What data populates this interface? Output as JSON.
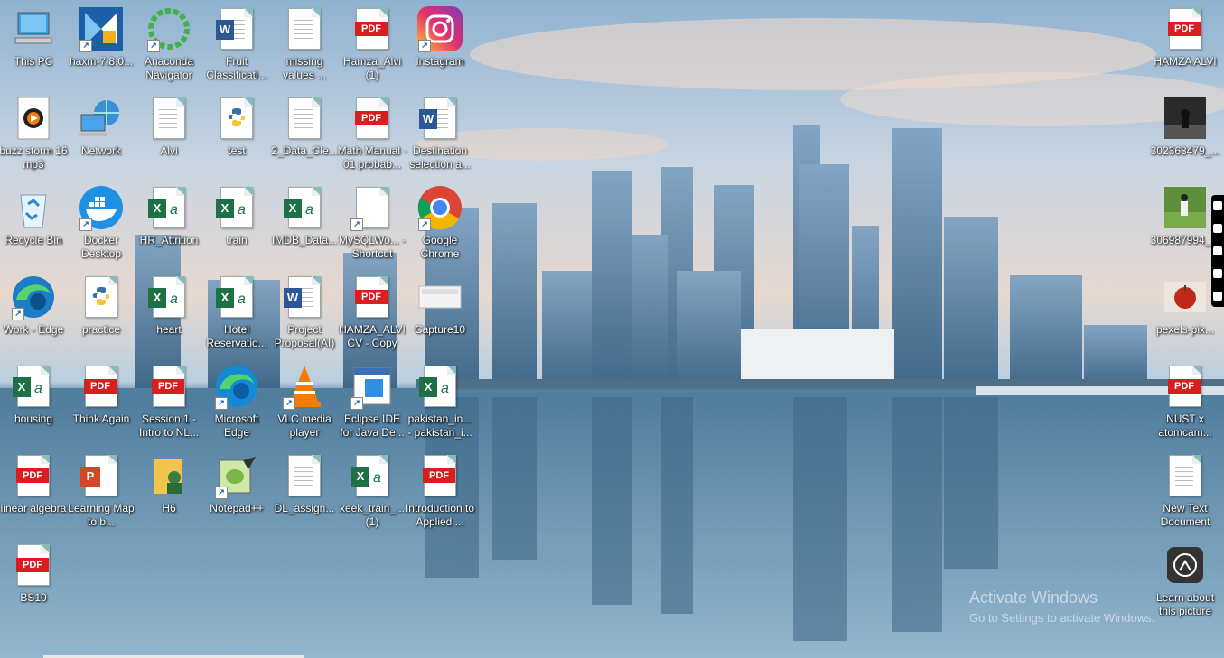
{
  "desktop": {
    "icons": [
      {
        "label": "This PC",
        "type": "pc"
      },
      {
        "label": "haxm-7.8.0...",
        "type": "haxm",
        "shortcut": true
      },
      {
        "label": "Anaconda Navigator",
        "type": "anaconda",
        "shortcut": true
      },
      {
        "label": "Fruit Classificati...",
        "type": "word"
      },
      {
        "label": "missing values ...",
        "type": "text"
      },
      {
        "label": "Hamza_Alvi (1)",
        "type": "pdf"
      },
      {
        "label": "Instagram",
        "type": "instagram",
        "shortcut": true
      },
      {
        "label": "buzz storm 16 mp3",
        "type": "media"
      },
      {
        "label": "Network",
        "type": "network"
      },
      {
        "label": "Alvi",
        "type": "text"
      },
      {
        "label": "test",
        "type": "python"
      },
      {
        "label": "2_Data_Cle...",
        "type": "text"
      },
      {
        "label": "Math Manual - 01 probab...",
        "type": "pdf"
      },
      {
        "label": "Destination selection a...",
        "type": "word"
      },
      {
        "label": "Recycle Bin",
        "type": "recycle"
      },
      {
        "label": "Docker Desktop",
        "type": "docker",
        "shortcut": true
      },
      {
        "label": "HR_Attrition",
        "type": "excel"
      },
      {
        "label": "train",
        "type": "excel"
      },
      {
        "label": "IMDB_Data...",
        "type": "excel"
      },
      {
        "label": "MySQLWo... - Shortcut",
        "type": "blank",
        "shortcut": true
      },
      {
        "label": "Google Chrome",
        "type": "chrome",
        "shortcut": true
      },
      {
        "label": "Work - Edge",
        "type": "edgework",
        "shortcut": true
      },
      {
        "label": "practice",
        "type": "python"
      },
      {
        "label": "heart",
        "type": "excel"
      },
      {
        "label": "Hotel Reservatio...",
        "type": "excel"
      },
      {
        "label": "Project Proposal(AI)",
        "type": "word"
      },
      {
        "label": "HAMZA_ALVI CV - Copy",
        "type": "pdf"
      },
      {
        "label": "Capture10",
        "type": "capture"
      },
      {
        "label": "housing",
        "type": "excel"
      },
      {
        "label": "Think Again",
        "type": "pdf"
      },
      {
        "label": "Session 1 - Intro to NL...",
        "type": "pdf"
      },
      {
        "label": "Microsoft Edge",
        "type": "edge",
        "shortcut": true
      },
      {
        "label": "VLC media player",
        "type": "vlc",
        "shortcut": true
      },
      {
        "label": "Eclipse IDE for Java De...",
        "type": "eclipse",
        "shortcut": true
      },
      {
        "label": "pakistan_in... - pakistan_i...",
        "type": "excel"
      },
      {
        "label": "linear algebra",
        "type": "pdf"
      },
      {
        "label": "Learning Map to b...",
        "type": "ppt"
      },
      {
        "label": "H6",
        "type": "folder"
      },
      {
        "label": "Notepad++",
        "type": "notepadpp",
        "shortcut": true
      },
      {
        "label": "DL_assign...",
        "type": "text"
      },
      {
        "label": "xeek_train_... (1)",
        "type": "excel"
      },
      {
        "label": "Introduction to Applied ...",
        "type": "pdf"
      },
      {
        "label": "BS10",
        "type": "pdf"
      }
    ],
    "right_icons": [
      {
        "label": "HAMZA ALVI",
        "type": "pdf"
      },
      {
        "label": "302363479_...",
        "type": "photo-dark"
      },
      {
        "label": "306987994_...",
        "type": "photo-green"
      },
      {
        "label": "pexels-pix...",
        "type": "photo-apple"
      },
      {
        "label": "NUST x atomcam...",
        "type": "pdf"
      },
      {
        "label": "New Text Document",
        "type": "text"
      },
      {
        "label": "Learn about this picture",
        "type": "spotlight"
      }
    ],
    "watermark_title": "Activate Windows",
    "watermark_sub": "Go to Settings to activate Windows."
  }
}
